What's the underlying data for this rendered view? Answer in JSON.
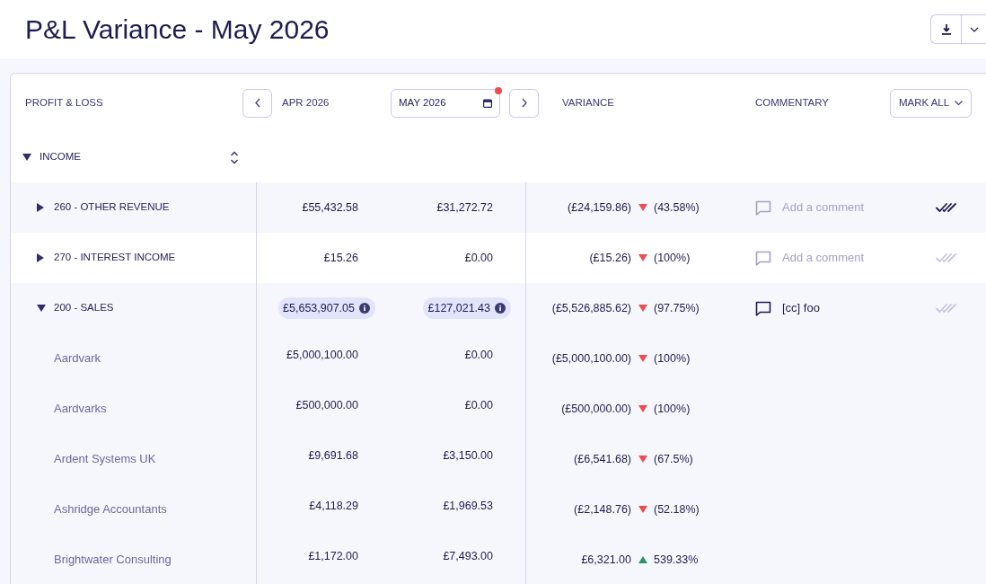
{
  "page": {
    "title": "P&L Variance - May 2026"
  },
  "report": {
    "header": {
      "section_label": "PROFIT & LOSS",
      "previous_period": "APR 2026",
      "current_period": {
        "value": "MAY 2026",
        "flagged": true
      },
      "variance_label": "VARIANCE",
      "commentary_label": "COMMENTARY",
      "mark_all_button": "MARK ALL"
    },
    "section": {
      "label": "INCOME",
      "expanded": true
    },
    "rows": [
      {
        "name": "260 - OTHER REVENUE",
        "expanded": false,
        "previous": "£55,432.58",
        "current": "£31,272.72",
        "breakdown": false,
        "variance": "(£24,159.86)",
        "increase": false,
        "variance_percent": "(43.58%)",
        "comment_placeholder": "Add a comment",
        "reviewed": true
      },
      {
        "name": "270 - INTEREST INCOME",
        "expanded": false,
        "previous": "£15.26",
        "current": "£0.00",
        "breakdown": false,
        "variance": "(£15.26)",
        "increase": false,
        "variance_percent": "(100%)",
        "comment_placeholder": "Add a comment",
        "reviewed": false
      },
      {
        "name": "200 - SALES",
        "expanded": true,
        "previous": "£5,653,907.05",
        "current": "£127,021.43",
        "breakdown": true,
        "variance": "(£5,526,885.62)",
        "increase": false,
        "variance_percent": "(97.75%)",
        "comment": "[cc] foo",
        "reviewed": false,
        "children": [
          {
            "name": "Aardvark",
            "previous": "£5,000,100.00",
            "current": "£0.00",
            "variance": "(£5,000,100.00)",
            "increase": false,
            "variance_percent": "(100%)"
          },
          {
            "name": "Aardvarks",
            "previous": "£500,000.00",
            "current": "£0.00",
            "variance": "(£500,000.00)",
            "increase": false,
            "variance_percent": "(100%)"
          },
          {
            "name": "Ardent Systems UK",
            "previous": "£9,691.68",
            "current": "£3,150.00",
            "variance": "(£6,541.68)",
            "increase": false,
            "variance_percent": "(67.5%)"
          },
          {
            "name": "Ashridge Accountants",
            "previous": "£4,118.29",
            "current": "£1,969.53",
            "variance": "(£2,148.76)",
            "increase": false,
            "variance_percent": "(52.18%)"
          },
          {
            "name": "Brightwater Consulting",
            "previous": "£1,172.00",
            "current": "£7,493.00",
            "variance": "£6,321.00",
            "increase": true,
            "variance_percent": "539.33%"
          }
        ]
      }
    ]
  }
}
